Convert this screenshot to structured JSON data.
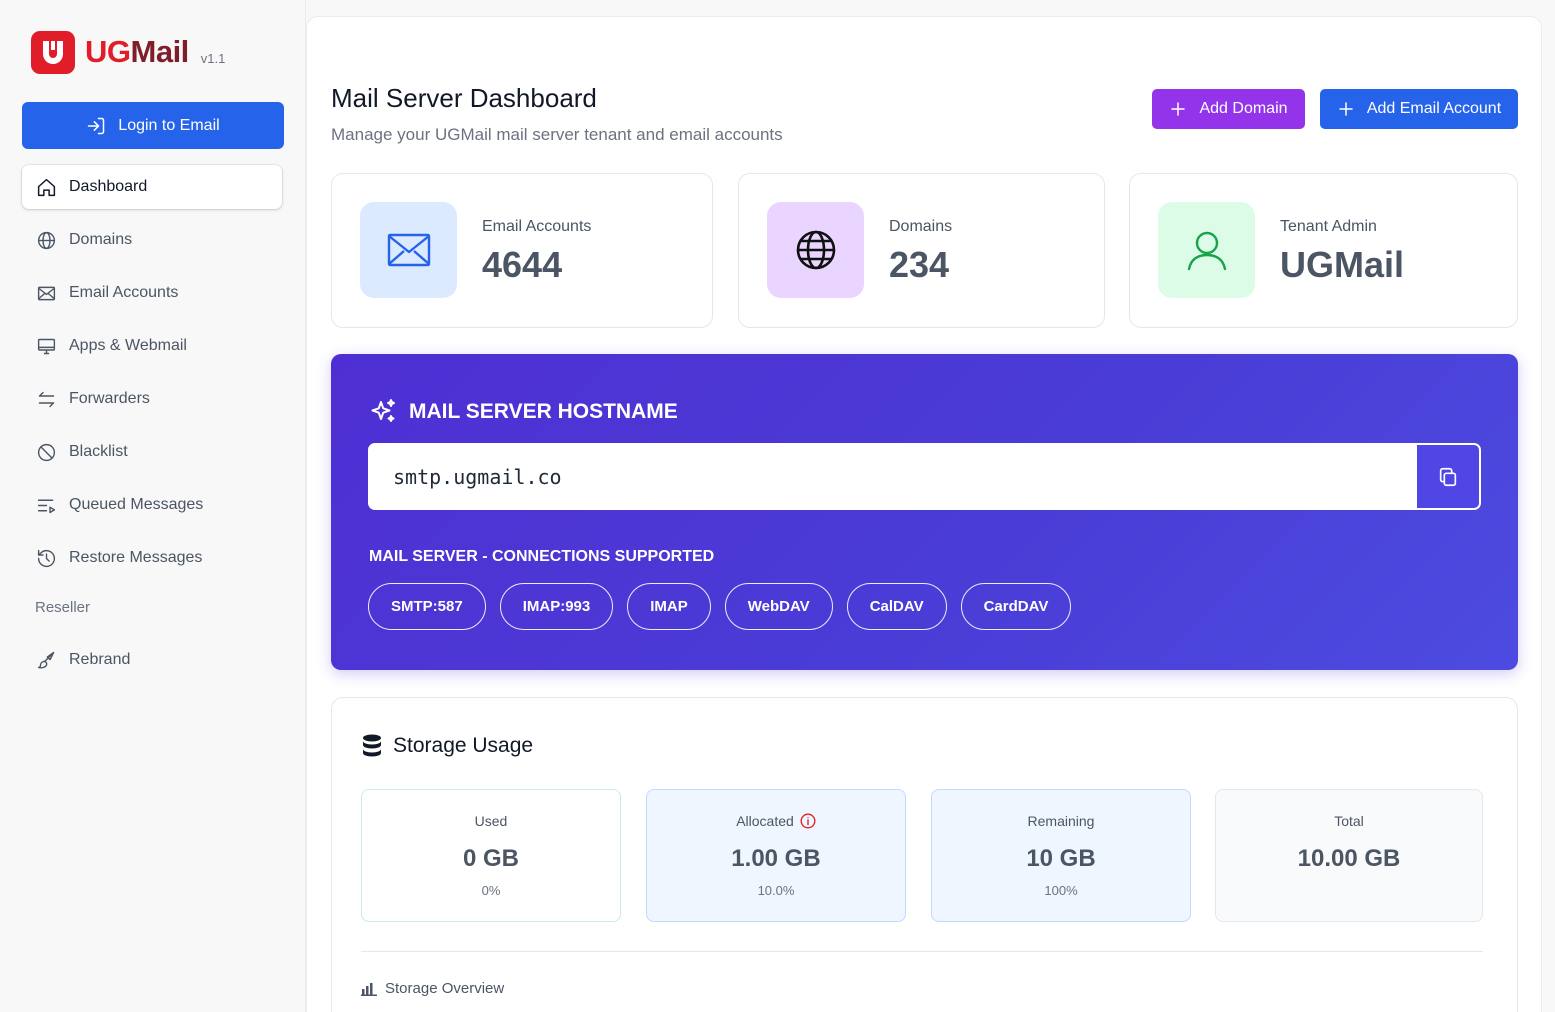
{
  "brand": {
    "name_prefix": "UG",
    "name_suffix": "Mail",
    "version": "v1.1",
    "colors": {
      "primary": "#e11d2a",
      "secondary": "#7f1d2a"
    }
  },
  "sidebar": {
    "login_button": "Login to Email",
    "items": [
      {
        "label": "Dashboard",
        "icon": "home-icon",
        "active": true
      },
      {
        "label": "Domains",
        "icon": "globe-icon"
      },
      {
        "label": "Email Accounts",
        "icon": "envelope-icon"
      },
      {
        "label": "Apps & Webmail",
        "icon": "monitor-icon"
      },
      {
        "label": "Forwarders",
        "icon": "arrows-exchange-icon"
      },
      {
        "label": "Blacklist",
        "icon": "ban-icon"
      },
      {
        "label": "Queued Messages",
        "icon": "queue-list-icon"
      },
      {
        "label": "Restore Messages",
        "icon": "history-icon"
      }
    ],
    "section_label": "Reseller",
    "reseller_items": [
      {
        "label": "Rebrand",
        "icon": "brush-icon"
      }
    ]
  },
  "header": {
    "title": "Mail Server Dashboard",
    "subtitle": "Manage your UGMail mail server tenant and email accounts",
    "add_domain": "Add Domain",
    "add_email_account": "Add Email Account"
  },
  "stats": [
    {
      "label": "Email Accounts",
      "value": "4644",
      "icon": "envelope-icon",
      "bg": "#dbeafe"
    },
    {
      "label": "Domains",
      "value": "234",
      "icon": "globe-icon",
      "bg": "#e9d5ff"
    },
    {
      "label": "Tenant Admin",
      "value": "UGMail",
      "icon": "user-icon",
      "bg": "#dcfce7"
    }
  ],
  "hostname": {
    "title": "MAIL SERVER HOSTNAME",
    "value": "smtp.ugmail.co",
    "connections_title": "MAIL SERVER - CONNECTIONS SUPPORTED",
    "connections": [
      "SMTP:587",
      "IMAP:993",
      "IMAP",
      "WebDAV",
      "CalDAV",
      "CardDAV"
    ]
  },
  "storage": {
    "title": "Storage Usage",
    "cards": [
      {
        "label": "Used",
        "value": "0 GB",
        "percent": "0%"
      },
      {
        "label": "Allocated",
        "value": "1.00 GB",
        "percent": "10.0%",
        "info": true
      },
      {
        "label": "Remaining",
        "value": "10 GB",
        "percent": "100%"
      },
      {
        "label": "Total",
        "value": "10.00 GB",
        "percent": ""
      }
    ],
    "overview_label": "Storage Overview"
  }
}
